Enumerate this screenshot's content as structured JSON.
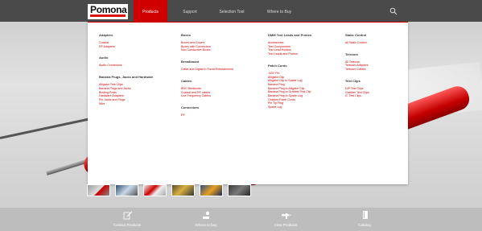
{
  "brand": {
    "logo_text": "Pomona"
  },
  "nav": {
    "items": [
      {
        "label": "Products",
        "active": true
      },
      {
        "label": "Support",
        "active": false
      },
      {
        "label": "Selection Tool",
        "active": false
      },
      {
        "label": "Where to Buy",
        "active": false
      }
    ],
    "search_icon": "search-icon"
  },
  "mega_menu": {
    "columns": [
      [
        {
          "title": "Adapters",
          "links": [
            "Coaxial",
            "RF Adapters"
          ]
        },
        {
          "title": "Audio",
          "links": [
            "Audio Connectors"
          ]
        },
        {
          "title": "Banana Plugs, Jacks and Hardware",
          "links": [
            "Alligator Test Clips",
            "Banana Plugs and Jacks",
            "Binding Posts",
            "Hardware Adapters",
            "Pin Jacks and Plugs",
            "Wire"
          ]
        }
      ],
      [
        {
          "title": "Boxes",
          "links": [
            "Boxes and Covers",
            "Boxes with Connectors",
            "Non Conductive Boxes"
          ]
        },
        {
          "title": "Breadboard",
          "links": [
            "Cable and Digital In Fiscal Entertainment"
          ]
        },
        {
          "title": "Cables",
          "links": [
            "BNC Breakouts",
            "Coaxial and RF cables",
            "Low Frequency Cables"
          ]
        },
        {
          "title": "Connectors",
          "links": [
            "RF"
          ]
        }
      ],
      [
        {
          "title": "DMM Test Leads and Probes",
          "links": [
            "Accessories",
            "Test Components",
            "Test Lead Holders",
            "Test Leads and Probes"
          ]
        },
        {
          "title": "Patch Cords",
          "links": [
            ".025\" Pin",
            "Alligator Clip",
            "Alligator Clip to Spade Lug",
            "Banana Plug",
            "Banana Plug to Alligator Clip",
            "Banana Plug to Grabber Test Clip",
            "Banana Plug to Spade Lug",
            "Grabber Patch Cords",
            "Pin Tip Plug",
            "Spade Lug"
          ]
        }
      ],
      [
        {
          "title": "Static Control",
          "links": [
            "All Static Control"
          ]
        },
        {
          "title": "Telecom",
          "links": [
            "All Telecom",
            "Telecom Adapters",
            "Telecom Cables"
          ]
        },
        {
          "title": "Test Clips",
          "links": [
            "DIP Test Clips",
            "Grabber Test Clips",
            "IC Test Clips"
          ]
        }
      ]
    ]
  },
  "bottom_bar": {
    "items": [
      {
        "label": "Contact Products",
        "icon": "edit-icon"
      },
      {
        "label": "Where to buy",
        "icon": "map-pin-icon"
      },
      {
        "label": "View Products",
        "icon": "probe-icon"
      },
      {
        "label": "Catalog",
        "icon": "book-icon"
      }
    ]
  },
  "colors": {
    "accent": "#d10000",
    "topbar": "#4a4a4a",
    "bottombar": "#bdbdbd"
  }
}
